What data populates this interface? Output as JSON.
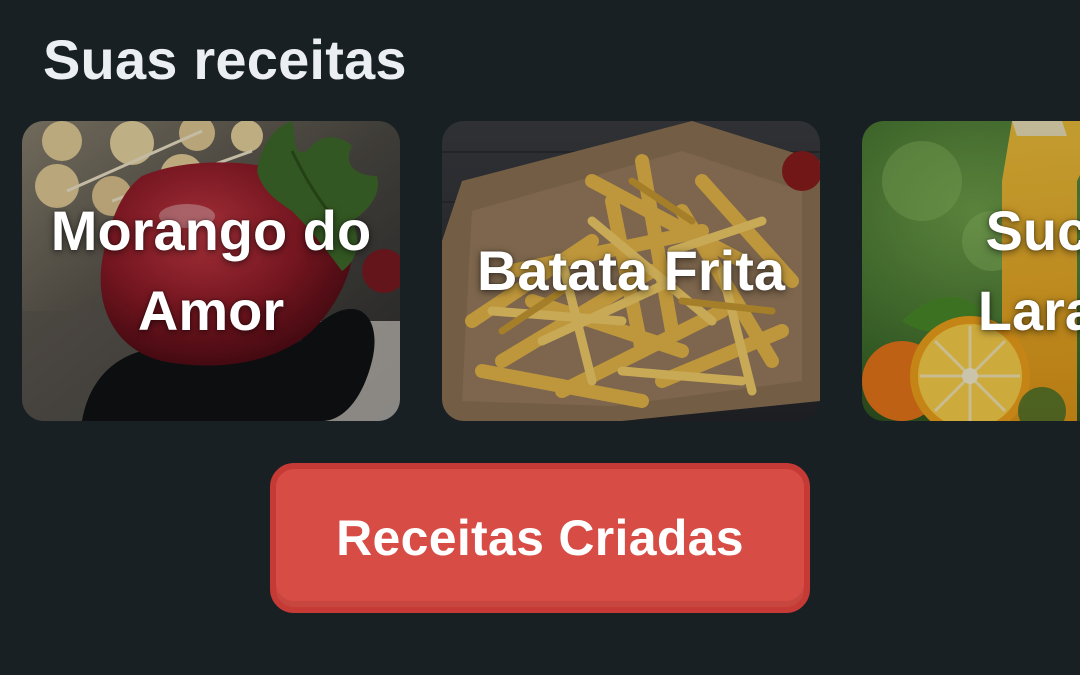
{
  "section": {
    "title": "Suas receitas"
  },
  "recipes": [
    {
      "title": "Morango do Amor",
      "image": "strawberry-photo"
    },
    {
      "title": "Batata Frita",
      "image": "french-fries-photo"
    },
    {
      "title": "Suco Laran",
      "image": "orange-juice-photo"
    }
  ],
  "cta": {
    "label": "Receitas Criadas",
    "color": "#d84c46"
  },
  "colors": {
    "background": "#182024",
    "title_text": "#eceff1"
  }
}
